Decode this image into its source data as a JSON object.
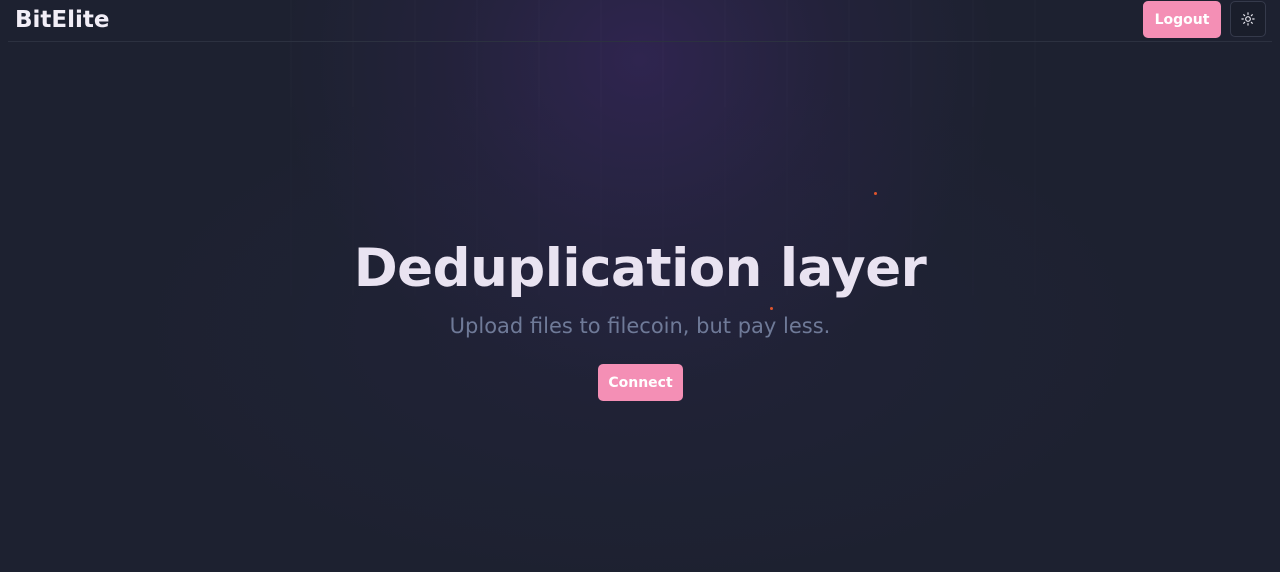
{
  "brand": {
    "name": "BitElite"
  },
  "navbar": {
    "logout_label": "Logout",
    "theme_toggle_icon": "sun-icon"
  },
  "hero": {
    "title": "Deduplication layer",
    "subtitle": "Upload files to filecoin, but pay less.",
    "connect_label": "Connect"
  },
  "colors": {
    "background": "#1d2130",
    "accent": "#f48fb5",
    "title_text": "#e9e3f1",
    "subtitle_text": "#6f7a98",
    "particle": "#e0542c"
  }
}
